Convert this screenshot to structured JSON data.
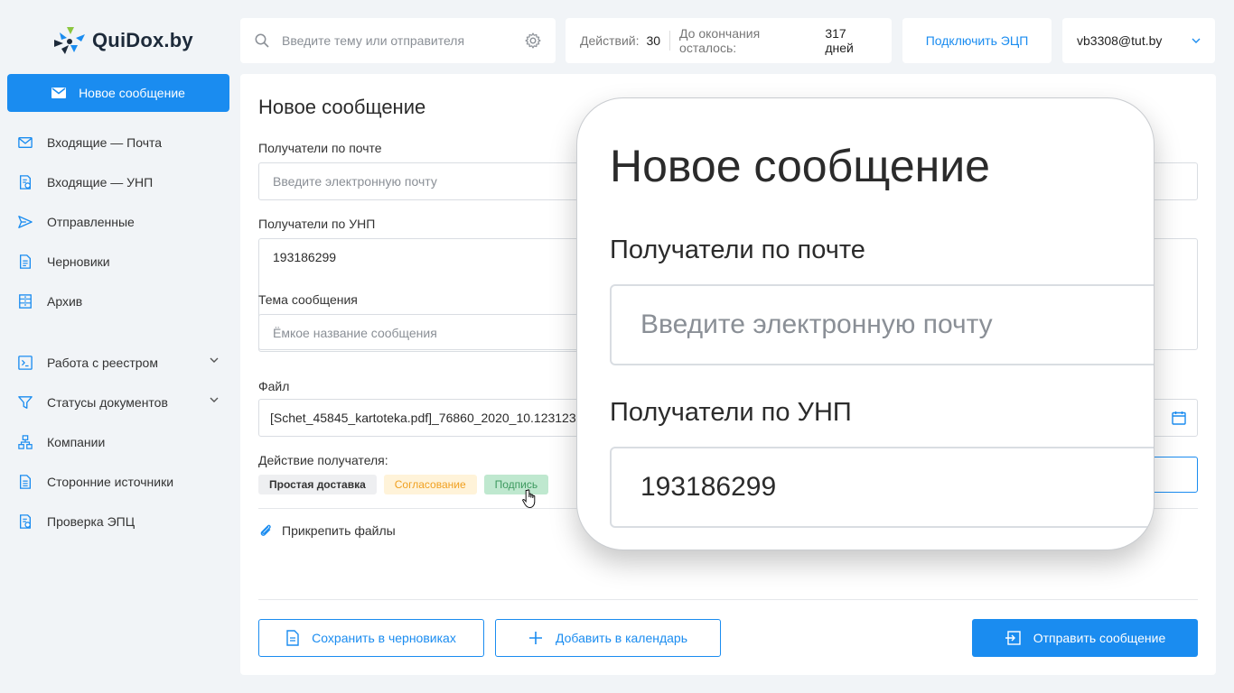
{
  "logo": {
    "text": "QuiDox.by"
  },
  "sidebar": {
    "new_message": "Новое сообщение",
    "items": [
      {
        "label": "Входящие — Почта",
        "icon": "mail-icon"
      },
      {
        "label": "Входящие — УНП",
        "icon": "document-badge-icon"
      },
      {
        "label": "Отправленные",
        "icon": "send-icon"
      },
      {
        "label": "Черновики",
        "icon": "draft-document-icon"
      },
      {
        "label": "Архив",
        "icon": "archive-icon"
      },
      {
        "label": "Работа с реестром",
        "icon": "registry-icon",
        "expandable": true
      },
      {
        "label": "Статусы документов",
        "icon": "filter-icon",
        "expandable": true
      },
      {
        "label": "Компании",
        "icon": "companies-icon"
      },
      {
        "label": "Сторонние источники",
        "icon": "external-document-icon"
      },
      {
        "label": "Проверка ЭПЦ",
        "icon": "verify-document-icon"
      }
    ]
  },
  "topbar": {
    "search_placeholder": "Введите тему или отправителя",
    "actions_label": "Действий:",
    "actions_value": "30",
    "remaining_label": "До окончания осталось:",
    "remaining_value": "317 дней",
    "connect_ecp": "Подключить ЭЦП",
    "user_email": "vb3308@tut.by"
  },
  "form": {
    "title": "Новое сообщение",
    "email_label": "Получатели по почте",
    "email_placeholder": "Введите электронную почту",
    "unp_label": "Получатели по УНП",
    "unp_value": "193186299",
    "subject_label": "Тема сообщения",
    "subject_placeholder": "Ёмкое название сообщения",
    "file_label": "Файл",
    "file_value": "[Schet_45845_kartoteka.pdf]_76860_2020_10.123123.",
    "action_label": "Действие получателя:",
    "action_chips": [
      "Простая доставка",
      "Согласование",
      "Подпись"
    ],
    "attach_label": "Прикрепить файлы",
    "save_draft": "Сохранить в черновиках",
    "add_calendar": "Добавить в календарь",
    "send": "Отправить сообщение"
  },
  "zoom": {
    "title": "Новое сообщение",
    "email_label": "Получатели по почте",
    "email_placeholder": "Введите электронную почту",
    "unp_label": "Получатели по УНП",
    "unp_value": "193186299"
  },
  "colors": {
    "accent": "#1a8cf0",
    "background": "#f1f4f7",
    "chip_yellow": "#f0a020",
    "chip_green": "#3d9a5f"
  }
}
